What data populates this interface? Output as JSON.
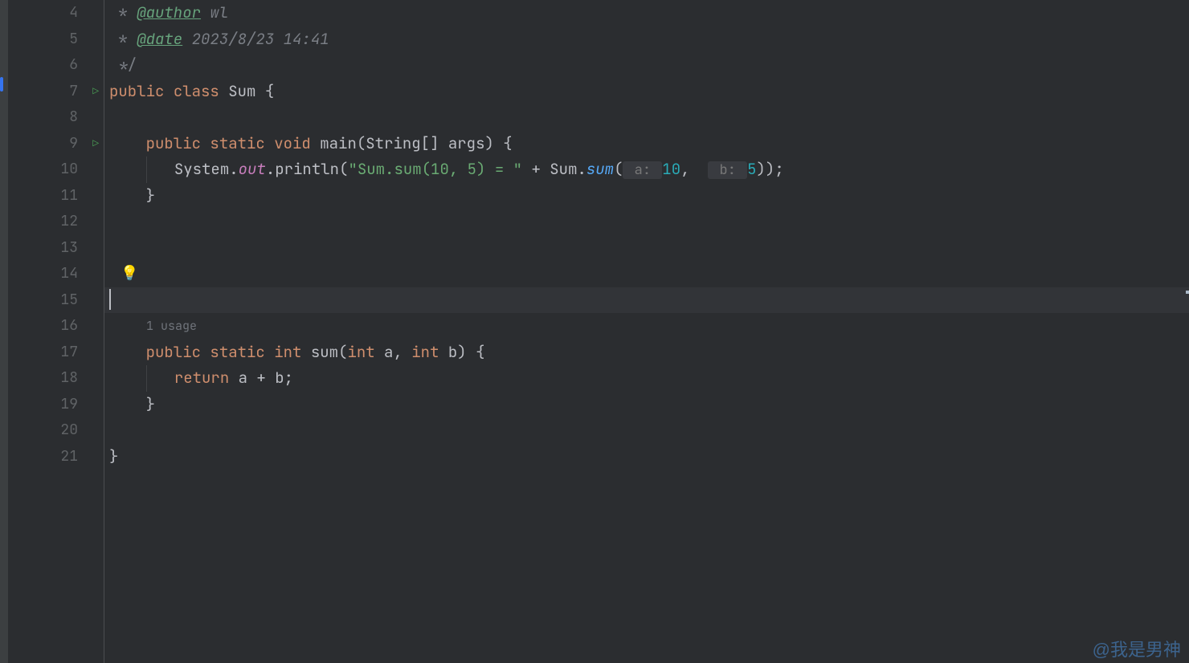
{
  "gutter": {
    "lines": [
      {
        "num": "4",
        "run": false
      },
      {
        "num": "5",
        "run": false
      },
      {
        "num": "6",
        "run": false
      },
      {
        "num": "7",
        "run": true
      },
      {
        "num": "8",
        "run": false
      },
      {
        "num": "9",
        "run": true
      },
      {
        "num": "10",
        "run": false
      },
      {
        "num": "11",
        "run": false
      },
      {
        "num": "12",
        "run": false
      },
      {
        "num": "13",
        "run": false
      },
      {
        "num": "14",
        "run": false
      },
      {
        "num": "15",
        "run": false
      },
      {
        "num": "16",
        "run": false
      },
      {
        "num": "17",
        "run": false
      },
      {
        "num": "18",
        "run": false
      },
      {
        "num": "19",
        "run": false
      },
      {
        "num": "20",
        "run": false
      },
      {
        "num": "21",
        "run": false
      }
    ]
  },
  "code": {
    "l4": {
      "prefix": " * ",
      "tag": "@author",
      "val": " wl"
    },
    "l5": {
      "prefix": " * ",
      "tag": "@date",
      "val": " 2023/8/23 14:41"
    },
    "l6": {
      "text": " */"
    },
    "l7": {
      "kw1": "public",
      "kw2": "class",
      "name": "Sum",
      "brace": " {"
    },
    "l9": {
      "kw1": "public",
      "kw2": "static",
      "kw3": "void",
      "method": "main",
      "params_open": "(",
      "type1": "String",
      "brackets": "[] ",
      "pname": "args",
      "params_close": ") {"
    },
    "l10": {
      "cls": "System",
      "dot1": ".",
      "field": "out",
      "dot2": ".",
      "call": "println",
      "open": "(",
      "str": "\"Sum.sum(10, 5) = \"",
      "plus": " + ",
      "cls2": "Sum",
      "dot3": ".",
      "call2": "sum",
      "open2": "(",
      "hint1": " a: ",
      "num1": "10",
      "comma": ",  ",
      "hint2": " b: ",
      "num2": "5",
      "close": "));"
    },
    "l11": {
      "brace": "}"
    },
    "usage": "1 usage",
    "l16": {
      "kw1": "public",
      "kw2": "static",
      "kw3": "int",
      "method": "sum",
      "open": "(",
      "t1": "int",
      "p1": " a",
      "comma": ", ",
      "t2": "int",
      "p2": " b",
      "close": ") {"
    },
    "l17": {
      "kw": "return",
      "expr": " a + b;"
    },
    "l18": {
      "brace": "}"
    },
    "l20": {
      "brace": "}"
    }
  },
  "watermark": "@我是男神"
}
